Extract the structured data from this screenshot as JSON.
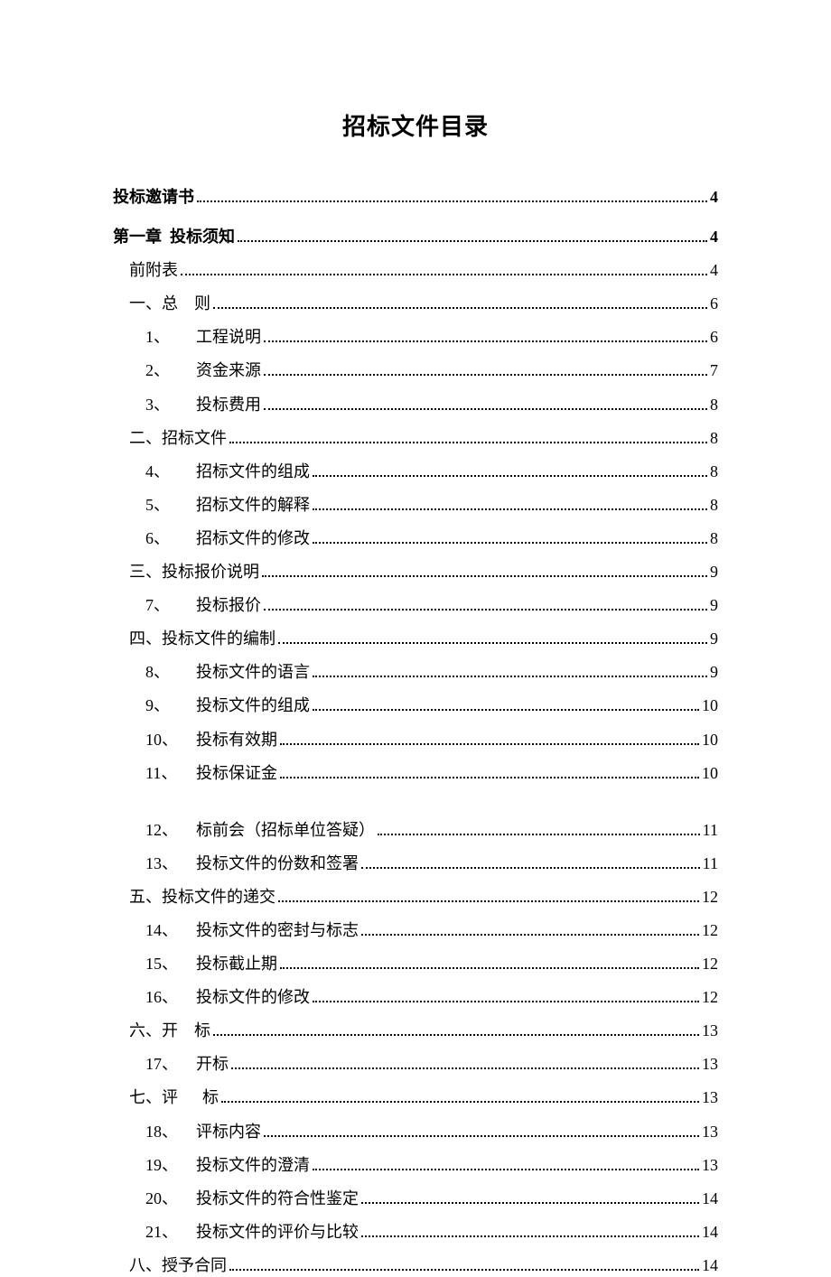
{
  "title": "招标文件目录",
  "entries": [
    {
      "label": "投标邀请书",
      "page": "4",
      "bold": true,
      "indent": 0
    },
    {
      "label": "第一章  投标须知",
      "page": "4",
      "bold": true,
      "indent": 0,
      "extraSpace": true
    },
    {
      "label": "前附表",
      "page": "4",
      "indent": 1
    },
    {
      "label": "一、总    则",
      "page": "6",
      "indent": 1
    },
    {
      "num": "1、",
      "label": "工程说明",
      "page": "6",
      "indent": 2
    },
    {
      "num": "2、",
      "label": "资金来源",
      "page": "7",
      "indent": 2
    },
    {
      "num": "3、",
      "label": "投标费用",
      "page": "8",
      "indent": 2
    },
    {
      "label": "二、招标文件",
      "page": "8",
      "indent": 1
    },
    {
      "num": "4、",
      "label": "招标文件的组成",
      "page": "8",
      "indent": 2
    },
    {
      "num": "5、",
      "label": "招标文件的解释",
      "page": "8",
      "indent": 2
    },
    {
      "num": "6、",
      "label": "招标文件的修改",
      "page": "8",
      "indent": 2
    },
    {
      "label": "三、投标报价说明",
      "page": "9",
      "indent": 1
    },
    {
      "num": "7、",
      "label": "投标报价",
      "page": "9",
      "indent": 2
    },
    {
      "label": "四、投标文件的编制",
      "page": "9",
      "indent": 1
    },
    {
      "num": "8、",
      "label": "投标文件的语言",
      "page": "9",
      "indent": 2
    },
    {
      "num": "9、",
      "label": "投标文件的组成",
      "page": "10",
      "indent": 2
    },
    {
      "num": "10、",
      "label": "投标有效期",
      "page": "10",
      "indent": 2
    },
    {
      "num": "11、",
      "label": "投标保证金",
      "page": "10",
      "indent": 2,
      "gapAfter": true
    },
    {
      "num": "12、",
      "label": "标前会（招标单位答疑）",
      "page": "11",
      "indent": 2
    },
    {
      "num": "13、",
      "label": "投标文件的份数和签署",
      "page": "11",
      "indent": 2
    },
    {
      "label": "五、投标文件的递交",
      "page": "12",
      "indent": 1
    },
    {
      "num": "14、",
      "label": "投标文件的密封与标志",
      "page": "12",
      "indent": 2
    },
    {
      "num": "15、",
      "label": "投标截止期",
      "page": "12",
      "indent": 2
    },
    {
      "num": "16、",
      "label": "投标文件的修改",
      "page": "12",
      "indent": 2
    },
    {
      "label": "六、开    标",
      "page": "13",
      "indent": 1
    },
    {
      "num": "17、",
      "label": "开标",
      "page": "13",
      "indent": 2
    },
    {
      "label": "七、评      标",
      "page": "13",
      "indent": 1
    },
    {
      "num": "18、",
      "label": "评标内容",
      "page": "13",
      "indent": 2
    },
    {
      "num": "19、",
      "label": "投标文件的澄清",
      "page": "13",
      "indent": 2
    },
    {
      "num": "20、",
      "label": "投标文件的符合性鉴定",
      "page": "14",
      "indent": 2
    },
    {
      "num": "21、",
      "label": "投标文件的评价与比较",
      "page": "14",
      "indent": 2
    },
    {
      "label": "八、授予合同",
      "page": "14",
      "indent": 1
    }
  ]
}
